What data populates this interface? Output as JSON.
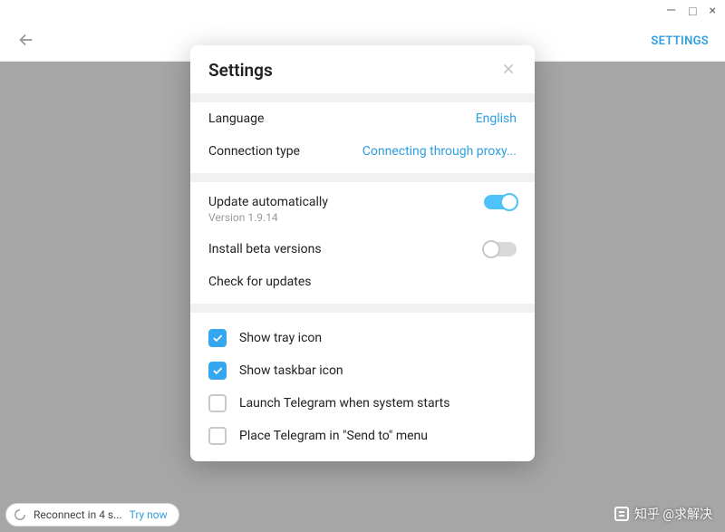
{
  "titlebar": {
    "minimize": "—",
    "maximize": "□",
    "close": "×"
  },
  "topbar": {
    "settings_link": "SETTINGS"
  },
  "modal": {
    "title": "Settings",
    "language_label": "Language",
    "language_value": "English",
    "connection_label": "Connection type",
    "connection_value": "Connecting through proxy...",
    "update_auto_label": "Update automatically",
    "version_text": "Version 1.9.14",
    "install_beta_label": "Install beta versions",
    "check_updates_label": "Check for updates",
    "show_tray_label": "Show tray icon",
    "show_taskbar_label": "Show taskbar icon",
    "launch_startup_label": "Launch Telegram when system starts",
    "sendto_label": "Place Telegram in \"Send to\" menu",
    "toggles": {
      "update_auto": true,
      "install_beta": false
    },
    "checks": {
      "tray": true,
      "taskbar": true,
      "startup": false,
      "sendto": false
    }
  },
  "statusbar": {
    "text": "Reconnect in 4 s...",
    "try_now": "Try now"
  },
  "watermark": {
    "text": "知乎 @求解决"
  }
}
